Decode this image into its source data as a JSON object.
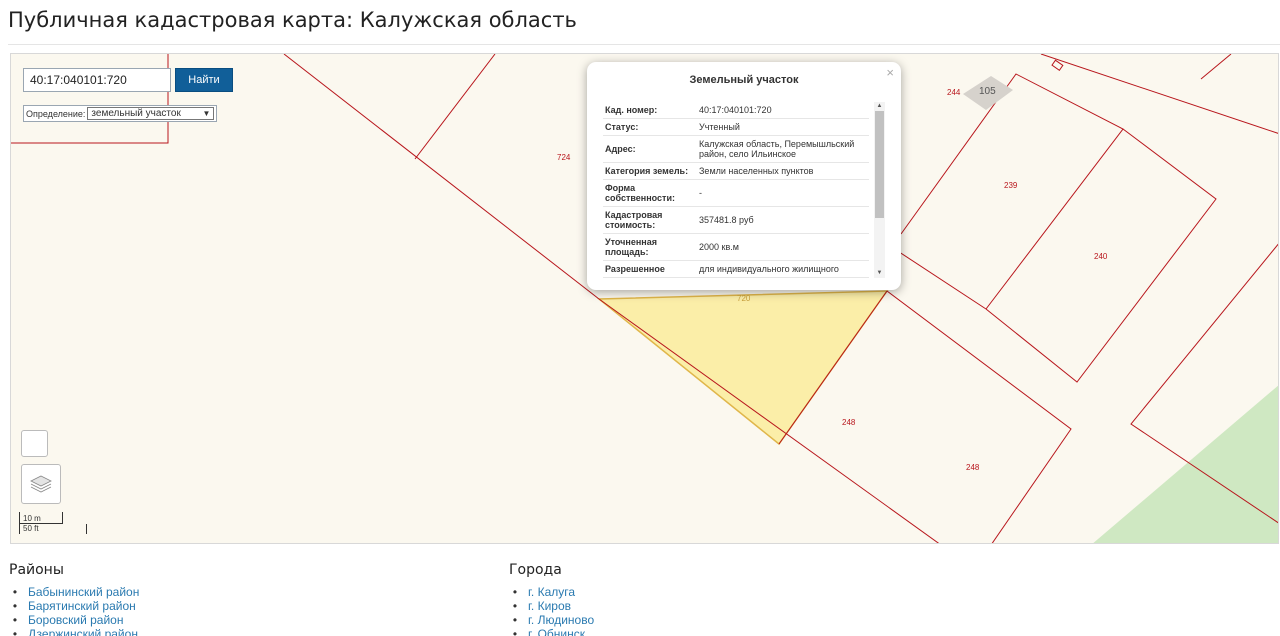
{
  "page": {
    "title": "Публичная кадастровая карта: Калужская область"
  },
  "search": {
    "value": "40:17:040101:720",
    "button_label": "Найти"
  },
  "definition": {
    "label": "Определение:",
    "selected": "земельный участок"
  },
  "popup": {
    "title": "Земельный участок",
    "close": "×",
    "rows": [
      {
        "label": "Кад. номер:",
        "value": "40:17:040101:720"
      },
      {
        "label": "Статус:",
        "value": "Учтенный"
      },
      {
        "label": "Адрес:",
        "value": "Калужская область, Перемышльский район, село Ильинское"
      },
      {
        "label": "Категория земель:",
        "value": "Земли населенных пунктов"
      },
      {
        "label": "Форма собственности:",
        "value": "-"
      },
      {
        "label": "Кадастровая стоимость:",
        "value": "357481.8 руб"
      },
      {
        "label": "Уточненная площадь:",
        "value": "2000 кв.м"
      },
      {
        "label": "Разрешенное",
        "value": "для индивидуального жилищного"
      }
    ],
    "scroll_position": 0,
    "scroll_visible_fraction": 0.68
  },
  "map": {
    "parcel_labels": [
      "724",
      "720",
      "244",
      "239",
      "240",
      "248",
      "248"
    ],
    "building_label": "105",
    "scale_metric": "10 m",
    "scale_imperial": "50 ft"
  },
  "footer": {
    "districts": {
      "heading": "Районы",
      "items": [
        "Бабынинский район",
        "Барятинский район",
        "Боровский район",
        "Дзержинский район"
      ]
    },
    "cities": {
      "heading": "Города",
      "items": [
        "г. Калуга",
        "г. Киров",
        "г. Людиново",
        "г. Обнинск"
      ]
    }
  },
  "colors": {
    "parcel_stroke": "#b8161c",
    "selected_fill": "#fbeea8",
    "selected_stroke": "#e0b64a",
    "green_area": "#cfe8c2",
    "map_bg": "#fbf8ef",
    "button": "#115f99",
    "link": "#2a7ab0"
  }
}
